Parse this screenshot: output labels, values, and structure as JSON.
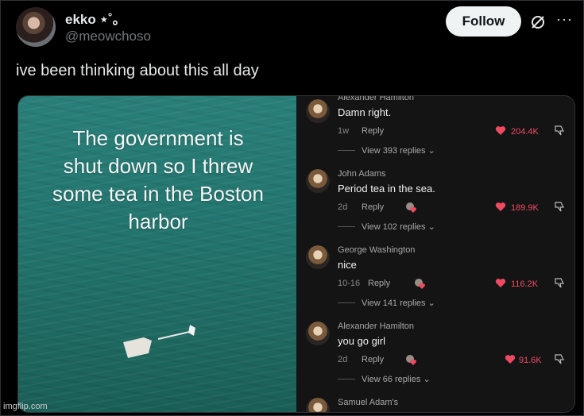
{
  "post": {
    "display_name": "ekko ⋆˚｡",
    "handle": "@meowchoso",
    "follow_label": "Follow",
    "more_label": "···",
    "text": "ive been thinking about this all day"
  },
  "media": {
    "video_caption": "The government is shut down so I threw some tea in the Boston harbor",
    "watermark": "imgflip.com"
  },
  "comments": [
    {
      "author": "Alexander Hamilton",
      "text": "Damn right.",
      "time": "1w",
      "reply": "Reply",
      "likes": "204.4K",
      "view_replies": "View 393 replies"
    },
    {
      "author": "John Adams",
      "text": "Period tea in the sea.",
      "time": "2d",
      "reply": "Reply",
      "likes": "189.9K",
      "view_replies": "View 102 replies"
    },
    {
      "author": "George Washington",
      "text": "nice",
      "time": "10-16",
      "reply": "Reply",
      "likes": "116.2K",
      "view_replies": "View 141 replies"
    },
    {
      "author": "Alexander Hamilton",
      "text": "you go girl",
      "time": "2d",
      "reply": "Reply",
      "likes": "91.6K",
      "view_replies": "View 66 replies"
    },
    {
      "author": "Samuel Adam's",
      "text": "",
      "time": "",
      "reply": "",
      "likes": "",
      "view_replies": ""
    }
  ],
  "colors": {
    "like_red": "#f04a63",
    "follow_bg": "#eff3f4",
    "water": "#23766f"
  }
}
